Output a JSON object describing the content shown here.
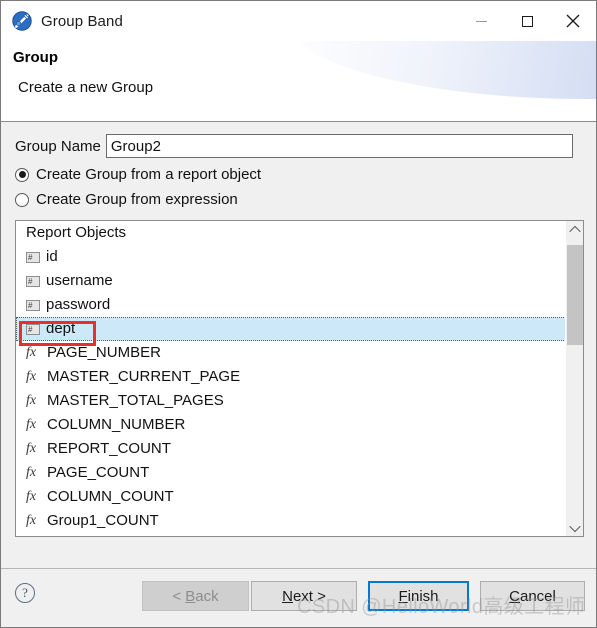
{
  "window": {
    "title": "Group Band",
    "app_icon": "group-band-app-icon",
    "minimize_label": "",
    "maximize_label": "",
    "close_label": "✕"
  },
  "header": {
    "title": "Group",
    "subtitle": "Create a new Group"
  },
  "form": {
    "group_name_label": "Group Name",
    "group_name_value": "Group2",
    "group_name_placeholder": "",
    "radios": [
      {
        "label": "Create Group from a report object",
        "selected": true
      },
      {
        "label": "Create Group from expression",
        "selected": false
      }
    ]
  },
  "tree": {
    "root_label": "Report Objects",
    "items": [
      {
        "label": "id",
        "icon": "field-icon",
        "icon_glyph": "#",
        "selected": false
      },
      {
        "label": "username",
        "icon": "field-icon",
        "icon_glyph": "#",
        "selected": false
      },
      {
        "label": "password",
        "icon": "field-icon",
        "icon_glyph": "#",
        "selected": false
      },
      {
        "label": "dept",
        "icon": "field-icon",
        "icon_glyph": "#",
        "selected": true
      },
      {
        "label": "PAGE_NUMBER",
        "icon": "function-icon",
        "icon_glyph": "fx",
        "selected": false
      },
      {
        "label": "MASTER_CURRENT_PAGE",
        "icon": "function-icon",
        "icon_glyph": "fx",
        "selected": false
      },
      {
        "label": "MASTER_TOTAL_PAGES",
        "icon": "function-icon",
        "icon_glyph": "fx",
        "selected": false
      },
      {
        "label": "COLUMN_NUMBER",
        "icon": "function-icon",
        "icon_glyph": "fx",
        "selected": false
      },
      {
        "label": "REPORT_COUNT",
        "icon": "function-icon",
        "icon_glyph": "fx",
        "selected": false
      },
      {
        "label": "PAGE_COUNT",
        "icon": "function-icon",
        "icon_glyph": "fx",
        "selected": false
      },
      {
        "label": "COLUMN_COUNT",
        "icon": "function-icon",
        "icon_glyph": "fx",
        "selected": false
      },
      {
        "label": "Group1_COUNT",
        "icon": "function-icon",
        "icon_glyph": "fx",
        "selected": false
      }
    ],
    "scrollbar": {
      "up_arrow": "scroll-up-icon",
      "down_arrow": "scroll-down-icon"
    }
  },
  "footer": {
    "help_glyph": "?",
    "buttons": [
      {
        "name": "back",
        "label": "< Back",
        "mnemonic": "B",
        "disabled": true,
        "primary": false
      },
      {
        "name": "next",
        "label": "Next >",
        "mnemonic": "N",
        "disabled": false,
        "primary": false
      },
      {
        "name": "finish",
        "label": "Finish",
        "mnemonic": "F",
        "disabled": false,
        "primary": true
      },
      {
        "name": "cancel",
        "label": "Cancel",
        "mnemonic": "C",
        "disabled": false,
        "primary": false
      }
    ]
  },
  "watermark": "CSDN @HelloWorld高级工程师",
  "colors": {
    "accent": "#0078d7",
    "selection": "#cde8f9",
    "annotation": "#e8302b",
    "dialog_bg": "#f0f0f0",
    "header_bg": "#ffffff"
  }
}
